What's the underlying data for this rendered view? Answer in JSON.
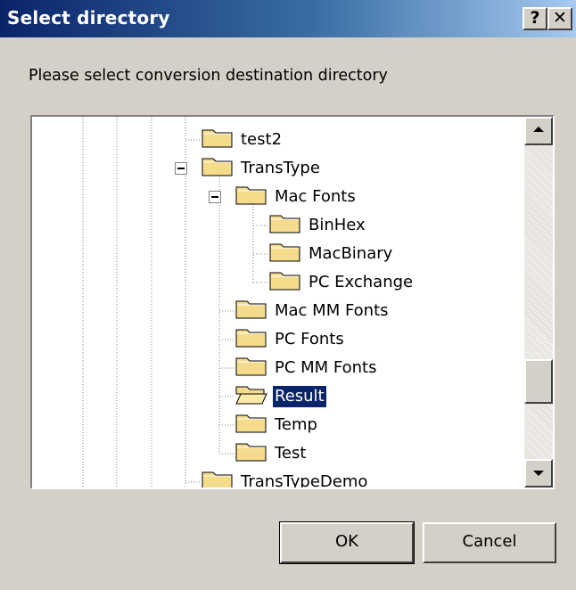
{
  "window": {
    "title": "Select directory",
    "help_label": "?",
    "close_label": "✕"
  },
  "prompt": "Please select conversion destination directory",
  "tree": {
    "items": [
      {
        "label": "test2",
        "icon": "folder-closed-icon",
        "selected": false
      },
      {
        "label": "TransType",
        "icon": "folder-closed-icon",
        "selected": false,
        "expanded": true
      },
      {
        "label": "Mac Fonts",
        "icon": "folder-closed-icon",
        "selected": false,
        "expanded": true
      },
      {
        "label": "BinHex",
        "icon": "folder-closed-icon",
        "selected": false
      },
      {
        "label": "MacBinary",
        "icon": "folder-closed-icon",
        "selected": false
      },
      {
        "label": "PC Exchange",
        "icon": "folder-closed-icon",
        "selected": false
      },
      {
        "label": "Mac MM Fonts",
        "icon": "folder-closed-icon",
        "selected": false
      },
      {
        "label": "PC Fonts",
        "icon": "folder-closed-icon",
        "selected": false
      },
      {
        "label": "PC MM Fonts",
        "icon": "folder-closed-icon",
        "selected": false
      },
      {
        "label": "Result",
        "icon": "folder-open-icon",
        "selected": true
      },
      {
        "label": "Temp",
        "icon": "folder-closed-icon",
        "selected": false
      },
      {
        "label": "Test",
        "icon": "folder-closed-icon",
        "selected": false
      },
      {
        "label": "TransTypeDemo",
        "icon": "folder-closed-icon",
        "selected": false
      }
    ]
  },
  "buttons": {
    "ok": "OK",
    "cancel": "Cancel"
  },
  "colors": {
    "titlebar_start": "#0a246a",
    "titlebar_end": "#a6caf0",
    "face": "#d4d0c8",
    "selection": "#0a246a",
    "folder": "#f5dc8c"
  }
}
